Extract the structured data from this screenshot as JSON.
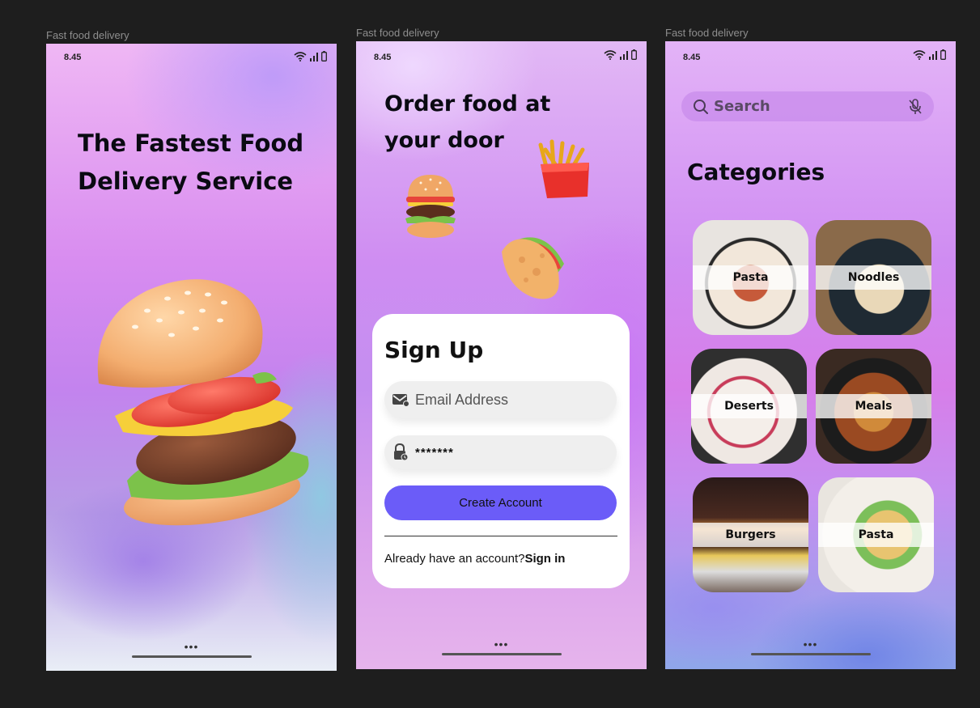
{
  "frames": [
    {
      "label": "Fast food delivery"
    },
    {
      "label": "Fast food delivery"
    },
    {
      "label": "Fast food delivery"
    }
  ],
  "status": {
    "time": "8.45"
  },
  "splash": {
    "title_line1": "The Fastest Food",
    "title_line2": "Delivery Service",
    "dots": "•••"
  },
  "signup": {
    "headline_line1": "Order food at",
    "headline_line2": "your door",
    "card_title": "Sign Up",
    "email_placeholder": "Email Address",
    "password_value": "*******",
    "create_button": "Create Account",
    "have_account": "Already have an account?",
    "sign_in": "Sign in",
    "dots": "•••"
  },
  "categories_screen": {
    "search_placeholder": "Search",
    "title": "Categories",
    "items": [
      {
        "label": "Pasta"
      },
      {
        "label": "Noodles"
      },
      {
        "label": "Deserts"
      },
      {
        "label": "Meals"
      },
      {
        "label": "Burgers"
      },
      {
        "label": "Pasta"
      }
    ],
    "dots": "•••"
  },
  "colors": {
    "accent_button": "#6b5cf8",
    "canvas_background": "#1e1e1e"
  }
}
